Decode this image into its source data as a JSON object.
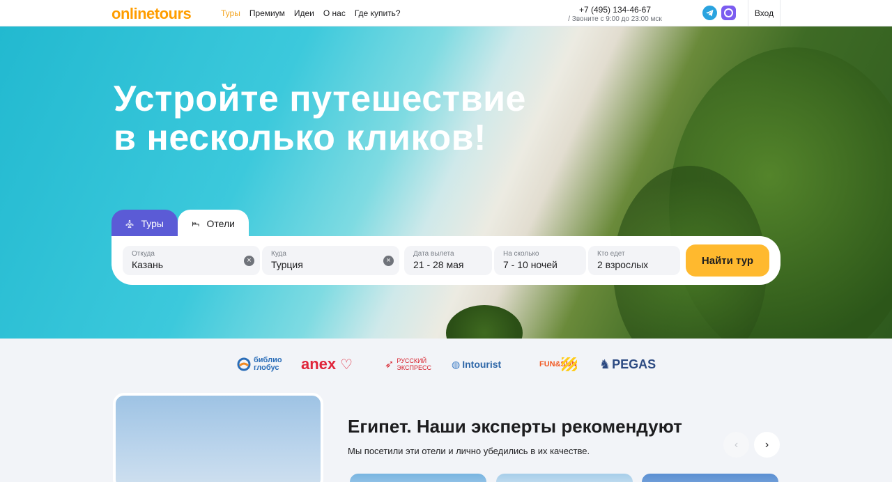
{
  "header": {
    "logo": "onlinetours",
    "nav": [
      "Туры",
      "Премиум",
      "Идеи",
      "О нас",
      "Где купить?"
    ],
    "active_nav": "Туры",
    "phone": "+7 (495) 134-46-67",
    "hours": "/ Звоните с 9:00 до 23:00 мск",
    "login": "Вход"
  },
  "hero": {
    "headline_line1": "Устройте путешествие",
    "headline_line2": "в несколько кликов!"
  },
  "search": {
    "tabs": {
      "tours": "Туры",
      "hotels": "Отели"
    },
    "from": {
      "label": "Откуда",
      "value": "Казань"
    },
    "to": {
      "label": "Куда",
      "value": "Турция"
    },
    "date": {
      "label": "Дата вылета",
      "value": "21 - 28 мая"
    },
    "nights": {
      "label": "На сколько",
      "value": "7 - 10 ночей"
    },
    "who": {
      "label": "Кто едет",
      "value": "2 взрослых"
    },
    "submit": "Найти тур",
    "clear_glyph": "×"
  },
  "partners": {
    "biblio_line1": "библио",
    "biblio_line2": "глобус",
    "anex": "anex",
    "russian_line1": "РУССКИЙ",
    "russian_line2": "ЭКСПРЕСС",
    "intourist": "Intourist",
    "funsun": "FUN&SUN",
    "pegas": "PEGAS"
  },
  "recommend": {
    "title": "Египет. Наши эксперты рекомендуют",
    "subtitle": "Мы посетили эти отели и лично убедились в их качестве.",
    "prev": "‹",
    "next": "›"
  },
  "colors": {
    "accent": "#ffb92e",
    "brand_orange": "#ff9d00",
    "tab_active": "#5b5bd6"
  }
}
